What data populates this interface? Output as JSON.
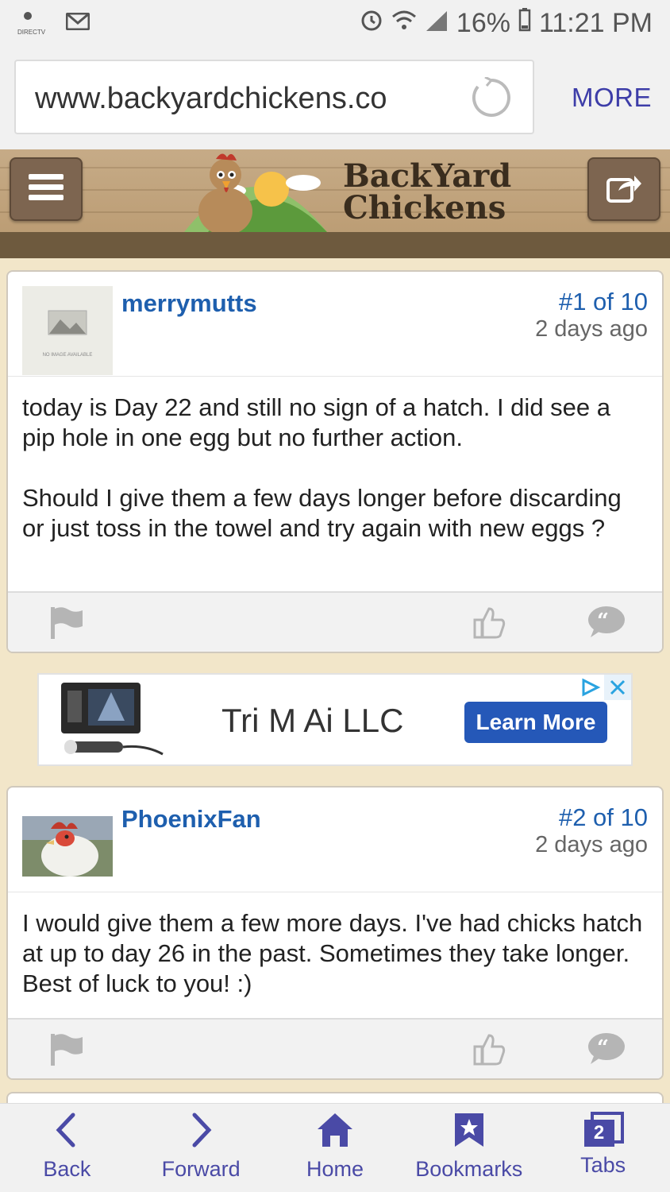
{
  "status_bar": {
    "carrier": "DIRECTV",
    "battery": "16%",
    "time": "11:21 PM"
  },
  "browser": {
    "url": "www.backyardchickens.co",
    "more_label": "MORE"
  },
  "site": {
    "logo_text_line1": "BackYard",
    "logo_text_line2": "Chickens"
  },
  "posts": [
    {
      "username": "merrymutts",
      "post_number": "#1 of 10",
      "time_ago": "2 days ago",
      "avatar_text": "NO IMAGE AVAILABLE",
      "body": "today is Day 22 and still no sign of a hatch. I did see a pip hole in one egg but no further action.\n\nShould I give them a few days longer before discarding or just toss in the towel and try again with new eggs ?"
    },
    {
      "username": "PhoenixFan",
      "post_number": "#2 of 10",
      "time_ago": "2 days ago",
      "body": "I would give them a few more days. I've had chicks hatch at up to day 26 in the past. Sometimes they take longer. Best of luck to you! :)"
    }
  ],
  "ad": {
    "title": "Tri M Ai LLC",
    "button_label": "Learn More"
  },
  "bottom_nav": {
    "back": "Back",
    "forward": "Forward",
    "home": "Home",
    "bookmarks": "Bookmarks",
    "tabs": "Tabs",
    "tab_count": "2"
  },
  "colors": {
    "link_blue": "#1e5fae",
    "nav_purple": "#4a4aa6",
    "ad_button": "#2558b8"
  }
}
